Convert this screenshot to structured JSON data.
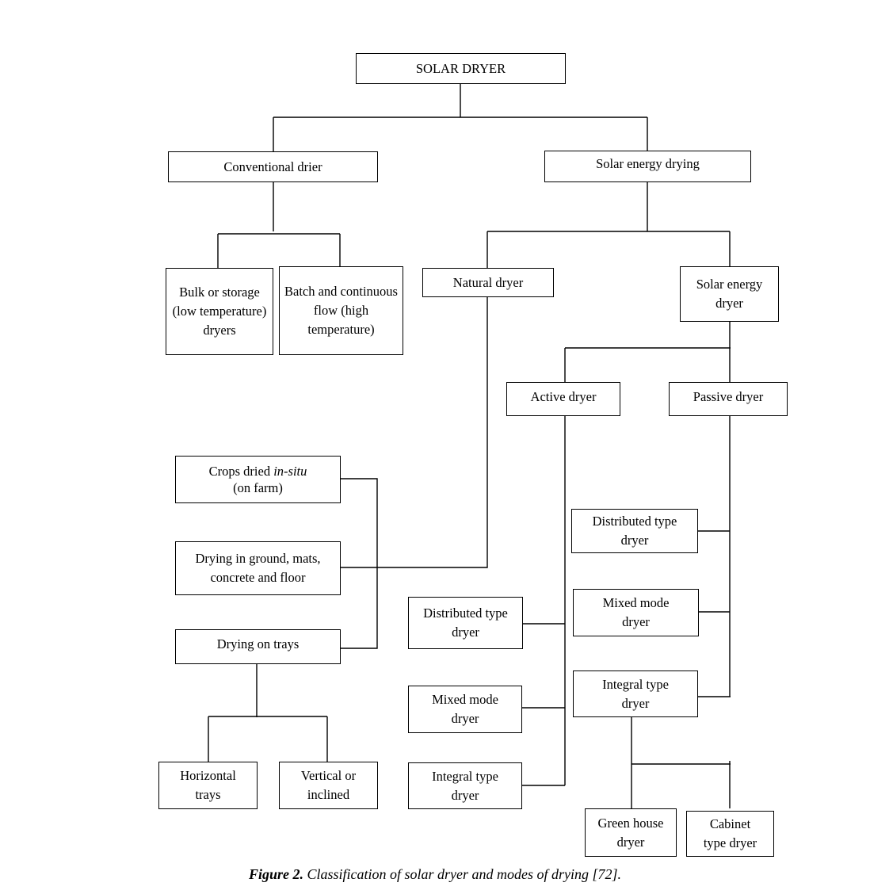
{
  "diagram": {
    "title": "Classification of solar dryer and modes of drying",
    "nodes": {
      "root": "SOLAR DRYER",
      "conventional": "Conventional drier",
      "solar_energy_drying": "Solar energy drying",
      "bulk": "Bulk or storage (low temperature) dryers",
      "batch": "Batch and continuous flow (high temperature)",
      "natural": "Natural dryer",
      "solar_energy_dryer": "Solar energy dryer",
      "active": "Active dryer",
      "passive": "Passive dryer",
      "crops_in_situ_prefix": "Crops dried ",
      "crops_in_situ_italic": "in-situ",
      "crops_in_situ_suffix": "(on farm)",
      "ground": "Drying in ground, mats, concrete and floor",
      "trays": "Drying on trays",
      "horizontal": "Horizontal trays",
      "vertical": "Vertical or inclined",
      "active_distributed": "Distributed type dryer",
      "active_mixed": "Mixed mode dryer",
      "active_integral": "Integral type dryer",
      "passive_distributed": "Distributed type dryer",
      "passive_mixed": "Mixed mode dryer",
      "passive_integral": "Integral type dryer",
      "greenhouse": "Green house dryer",
      "cabinet": "Cabinet type dryer"
    },
    "edges": [
      [
        "SOLAR DRYER",
        "Conventional drier"
      ],
      [
        "SOLAR DRYER",
        "Solar energy drying"
      ],
      [
        "Conventional drier",
        "Bulk or storage (low temperature) dryers"
      ],
      [
        "Conventional drier",
        "Batch and continuous flow (high temperature)"
      ],
      [
        "Solar energy drying",
        "Natural dryer"
      ],
      [
        "Solar energy drying",
        "Solar energy dryer"
      ],
      [
        "Solar energy dryer",
        "Active dryer"
      ],
      [
        "Solar energy dryer",
        "Passive dryer"
      ],
      [
        "Natural dryer",
        "Crops dried in-situ (on farm)"
      ],
      [
        "Natural dryer",
        "Drying in ground, mats, concrete and floor"
      ],
      [
        "Natural dryer",
        "Drying on trays"
      ],
      [
        "Drying on trays",
        "Horizontal trays"
      ],
      [
        "Drying on trays",
        "Vertical or inclined"
      ],
      [
        "Active dryer",
        "Distributed type dryer"
      ],
      [
        "Active dryer",
        "Mixed mode dryer"
      ],
      [
        "Active dryer",
        "Integral type dryer"
      ],
      [
        "Passive dryer",
        "Distributed type dryer"
      ],
      [
        "Passive dryer",
        "Mixed mode dryer"
      ],
      [
        "Passive dryer",
        "Integral type dryer"
      ],
      [
        "Integral type dryer (passive)",
        "Green house dryer"
      ],
      [
        "Integral type dryer (passive)",
        "Cabinet type dryer"
      ]
    ]
  },
  "caption": {
    "figure_label": "Figure 2.",
    "text": " Classification of solar dryer and modes of drying [72]."
  }
}
